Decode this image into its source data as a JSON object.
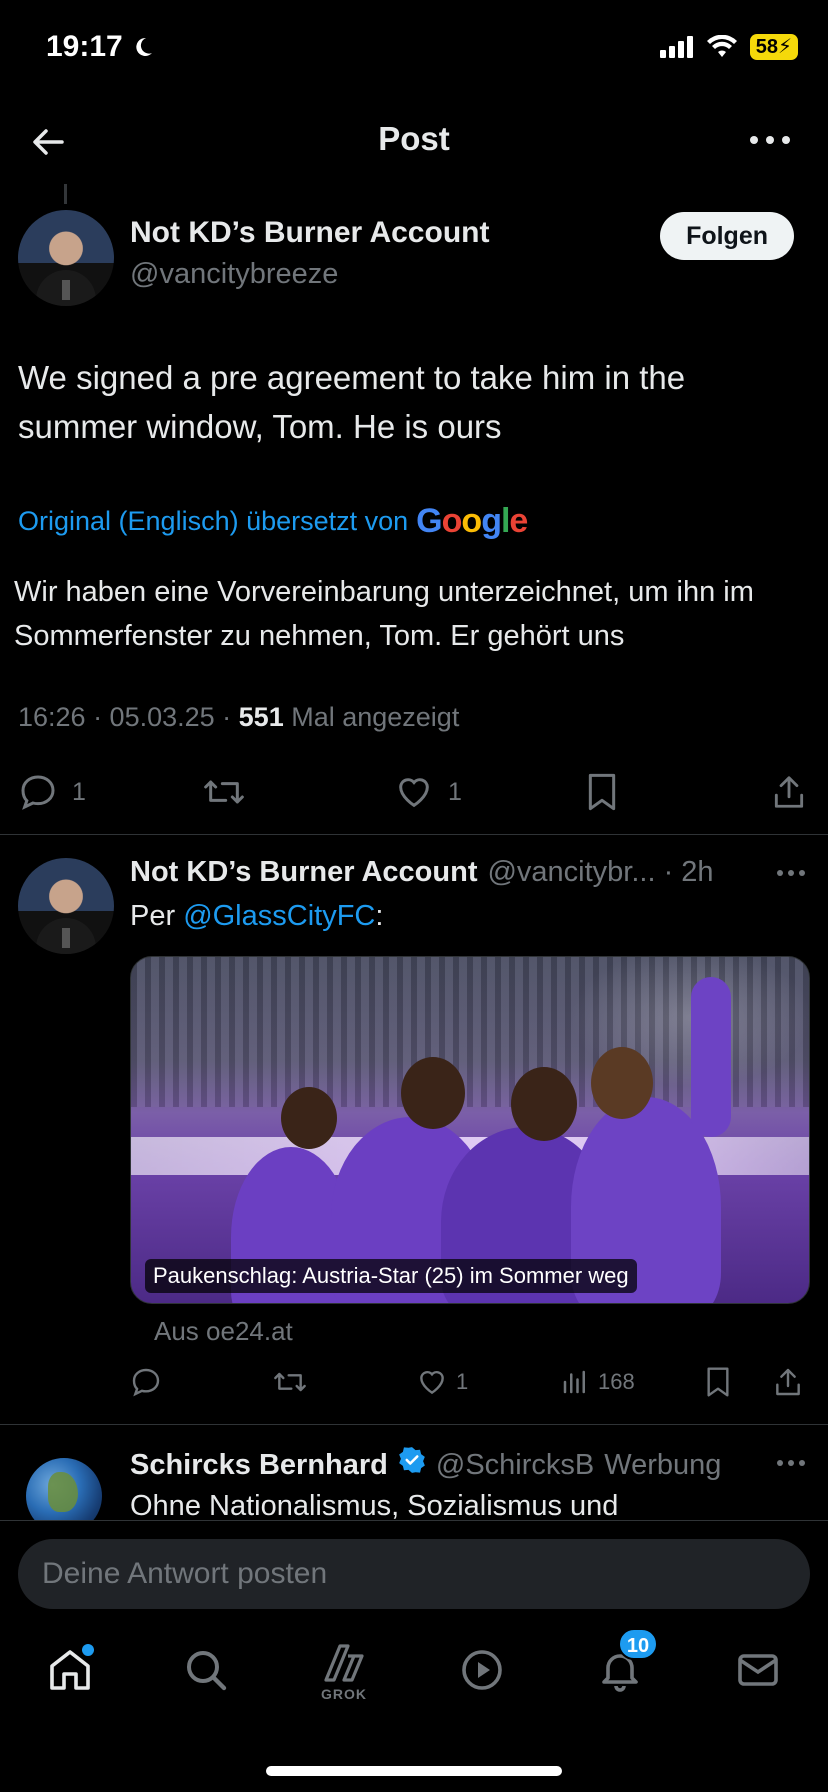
{
  "status_bar": {
    "time": "19:17",
    "battery": "58"
  },
  "nav": {
    "title": "Post"
  },
  "main_post": {
    "author_name": "Not KD’s Burner Account",
    "author_handle": "@vancitybreeze",
    "follow_label": "Folgen",
    "text": "We signed a pre agreement to take him in the summer window, Tom. He is ours",
    "translation_note": "Original (Englisch) übersetzt von",
    "translation_provider": [
      "G",
      "o",
      "o",
      "g",
      "l",
      "e"
    ],
    "translated_text": "Wir haben eine Vorvereinbarung unterzeichnet, um ihn im Sommerfenster zu nehmen, Tom. Er gehört uns",
    "time": "16:26 · 05.03.25 · ",
    "views": "551",
    "views_label": " Mal angezeigt",
    "reply_count": "1",
    "like_count": "1"
  },
  "reply_post": {
    "author_name": "Not KD’s Burner Account",
    "author_handle": "@vancitybr... · 2h",
    "text_prefix": "Per ",
    "mention": "@GlassCityFC",
    "text_suffix": ":",
    "card_caption": "Paukenschlag: Austria-Star (25) im Sommer weg",
    "card_source": "Aus oe24.at",
    "like_count": "1",
    "view_count": "168"
  },
  "ad_post": {
    "author_name": "Schircks Bernhard",
    "author_handle": "@SchircksB",
    "ad_label": "Werbung",
    "text": "Ohne Nationalismus, Sozialismus und"
  },
  "reply_box": {
    "placeholder": "Deine Antwort posten"
  },
  "tabbar": {
    "grok_label": "GROK",
    "notifications_badge": "10"
  },
  "colors": {
    "accent": "#1d9bf0",
    "background": "#000000",
    "secondary_text": "#71767b",
    "primary_text": "#e7e9ea"
  }
}
